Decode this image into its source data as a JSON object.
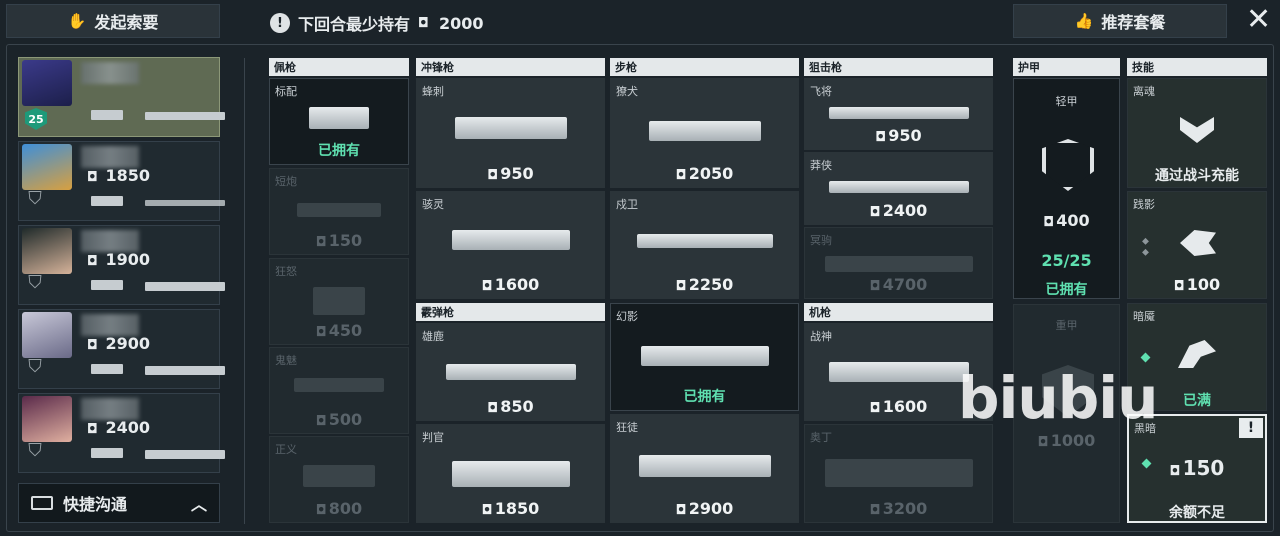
{
  "top": {
    "request_label": "发起索要",
    "min_hold_label": "下回合最少持有",
    "min_hold_value": "2000",
    "recommend_label": "推荐套餐"
  },
  "team": [
    {
      "credits": "",
      "level": "25",
      "self": true
    },
    {
      "credits": "1850"
    },
    {
      "credits": "1900"
    },
    {
      "credits": "2900"
    },
    {
      "credits": "2400"
    }
  ],
  "comm_label": "快捷沟通",
  "categories": {
    "sidearm": "佩枪",
    "smg": "冲锋枪",
    "shotgun": "霰弹枪",
    "rifle": "步枪",
    "sniper": "狙击枪",
    "mg": "机枪",
    "armor": "护甲",
    "skills": "技能"
  },
  "weapons": {
    "sidearm": [
      {
        "name": "标配",
        "price": "已拥有"
      },
      {
        "name": "短炮",
        "price": "150"
      },
      {
        "name": "狂怒",
        "price": "450"
      },
      {
        "name": "鬼魅",
        "price": "500"
      },
      {
        "name": "正义",
        "price": "800"
      }
    ],
    "smg": [
      {
        "name": "蜂刺",
        "price": "950"
      },
      {
        "name": "骇灵",
        "price": "1600"
      }
    ],
    "shotgun": [
      {
        "name": "雄鹿",
        "price": "850"
      },
      {
        "name": "判官",
        "price": "1850"
      }
    ],
    "rifle": [
      {
        "name": "獠犬",
        "price": "2050"
      },
      {
        "name": "戍卫",
        "price": "2250"
      },
      {
        "name": "幻影",
        "price": "已拥有"
      },
      {
        "name": "狂徒",
        "price": "2900"
      }
    ],
    "sniper": [
      {
        "name": "飞将",
        "price": "950"
      },
      {
        "name": "莽侠",
        "price": "2400"
      },
      {
        "name": "冥驹",
        "price": "4700"
      }
    ],
    "mg": [
      {
        "name": "战神",
        "price": "1600"
      },
      {
        "name": "奥丁",
        "price": "3200"
      }
    ]
  },
  "armor": [
    {
      "name": "轻甲",
      "price": "400",
      "count": "25/25",
      "status": "已拥有"
    },
    {
      "name": "重甲",
      "price": "1000"
    }
  ],
  "skills": [
    {
      "name": "离魂",
      "status": "通过战斗充能"
    },
    {
      "name": "践影",
      "price": "100"
    },
    {
      "name": "暗魇",
      "status": "已满"
    },
    {
      "name": "黑暗",
      "price": "150",
      "status": "余额不足"
    }
  ],
  "watermark": "biubiu",
  "icons": {
    "credit": "credit-icon",
    "close": "close-icon"
  }
}
